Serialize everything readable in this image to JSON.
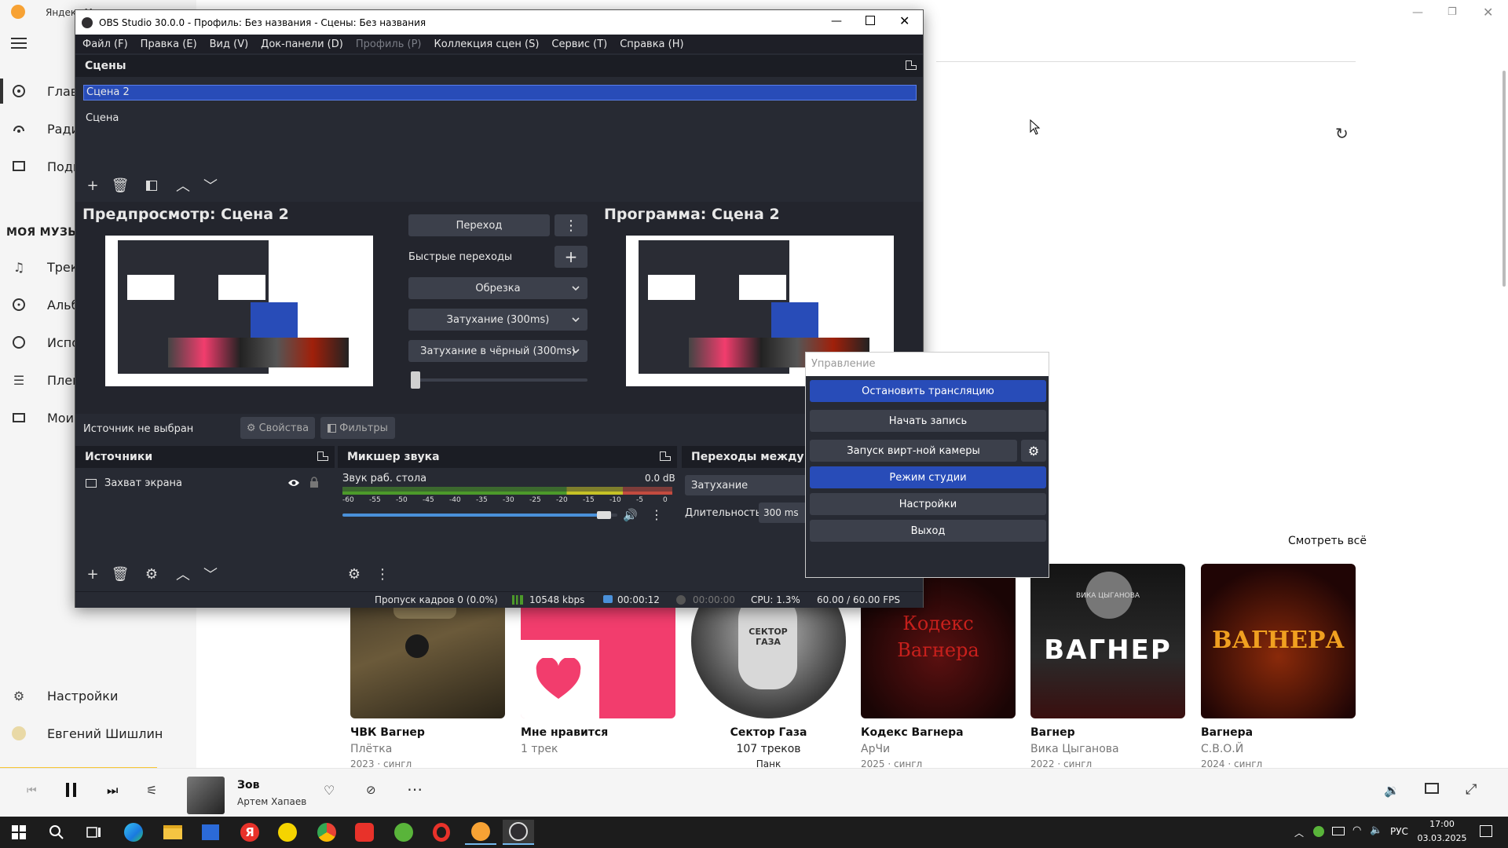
{
  "music": {
    "browser_label": "Яндекс М",
    "sidebar": {
      "items": [
        {
          "label": "Главн",
          "icon": "home-icon"
        },
        {
          "label": "Ради",
          "icon": "radio-icon"
        },
        {
          "label": "Подк",
          "icon": "podcast-icon"
        }
      ],
      "section_label": "МОЯ МУЗЫК",
      "my_items": [
        {
          "label": "Трек",
          "icon": "music-note-icon"
        },
        {
          "label": "Альб",
          "icon": "disc-icon"
        },
        {
          "label": "Испо",
          "icon": "artist-icon"
        },
        {
          "label": "Плей",
          "icon": "playlist-icon"
        },
        {
          "label": "Мои",
          "icon": "library-icon"
        }
      ],
      "settings_label": "Настройки",
      "user_name": "Евгений Шишлин"
    },
    "see_all": "Смотреть всё",
    "cards": [
      {
        "title": "ЧВК Вагнер",
        "subtitle": "Плётка",
        "meta": "2023 · сингл"
      },
      {
        "title": "Мне нравится",
        "subtitle": "1 трек",
        "meta": ""
      },
      {
        "title": "Сектор Газа",
        "subtitle": "107 треков",
        "meta": "Панк"
      },
      {
        "title": "Кодекс Вагнера",
        "subtitle": "АрЧи",
        "meta": "2025 · сингл"
      },
      {
        "title": "Вагнер",
        "subtitle": "Вика Цыганова",
        "meta": "2022 · сингл"
      },
      {
        "title": "Вагнера",
        "subtitle": "С.В.О.Й",
        "meta": "2024 · сингл"
      }
    ],
    "cover_text": {
      "c3": "СЕКТОР ГАЗА",
      "c4": "Кодекс Вагнера",
      "c5_small": "ВИКА ЦЫГАНОВА",
      "c5": "ВАГНЕР",
      "c6": "ВАГНЕРА"
    },
    "player": {
      "track_title": "Зов",
      "track_artist": "Артем Хапаев"
    }
  },
  "obs": {
    "title": "OBS Studio 30.0.0 - Профиль: Без названия - Сцены: Без названия",
    "menu": [
      "Файл (F)",
      "Правка (E)",
      "Вид (V)",
      "Док-панели (D)",
      "Профиль (P)",
      "Коллекция сцен (S)",
      "Сервис (T)",
      "Справка (H)"
    ],
    "scenes_title": "Сцены",
    "scenes": [
      "Сцена 2",
      "Сцена"
    ],
    "preview_title": "Предпросмотр: Сцена 2",
    "program_title": "Программа: Сцена 2",
    "transition_button": "Переход",
    "quick_transitions": "Быстрые переходы",
    "quick_list": [
      "Обрезка",
      "Затухание (300ms)",
      "Затухание в чёрный (300ms)"
    ],
    "no_source": "Источник не выбран",
    "properties": "Свойства",
    "filters": "Фильтры",
    "sources_title": "Источники",
    "sources": [
      "Захват экрана"
    ],
    "mixer_title": "Микшер звука",
    "mixer_channel": "Звук раб. стола",
    "mixer_db": "0.0 dB",
    "mixer_ticks": [
      "-60",
      "-55",
      "-50",
      "-45",
      "-40",
      "-35",
      "-30",
      "-25",
      "-20",
      "-15",
      "-10",
      "-5",
      "0"
    ],
    "mixer_level": 0.95,
    "transitions_title": "Переходы между сц",
    "transition_select": "Затухание",
    "duration_label": "Длительность",
    "duration_value": "300 ms",
    "controls_title": "Управление",
    "controls": [
      {
        "label": "Остановить трансляцию",
        "active": true
      },
      {
        "label": "Начать запись",
        "active": false
      },
      {
        "label": "Запуск вирт-ной камеры",
        "active": false
      },
      {
        "label": "Режим студии",
        "active": true
      },
      {
        "label": "Настройки",
        "active": false
      },
      {
        "label": "Выход",
        "active": false
      }
    ],
    "status": {
      "dropped": "Пропуск кадров 0 (0.0%)",
      "bitrate": "10548 kbps",
      "stream_time": "00:00:12",
      "rec_time": "00:00:00",
      "cpu": "CPU: 1.3%",
      "fps": "60.00 / 60.00 FPS"
    },
    "colors": {
      "bg": "#272a33",
      "active": "#284cb8",
      "panel": "#1b1d24"
    }
  },
  "taskbar": {
    "lang": "РУС",
    "time": "17:00",
    "date": "03.03.2025"
  }
}
